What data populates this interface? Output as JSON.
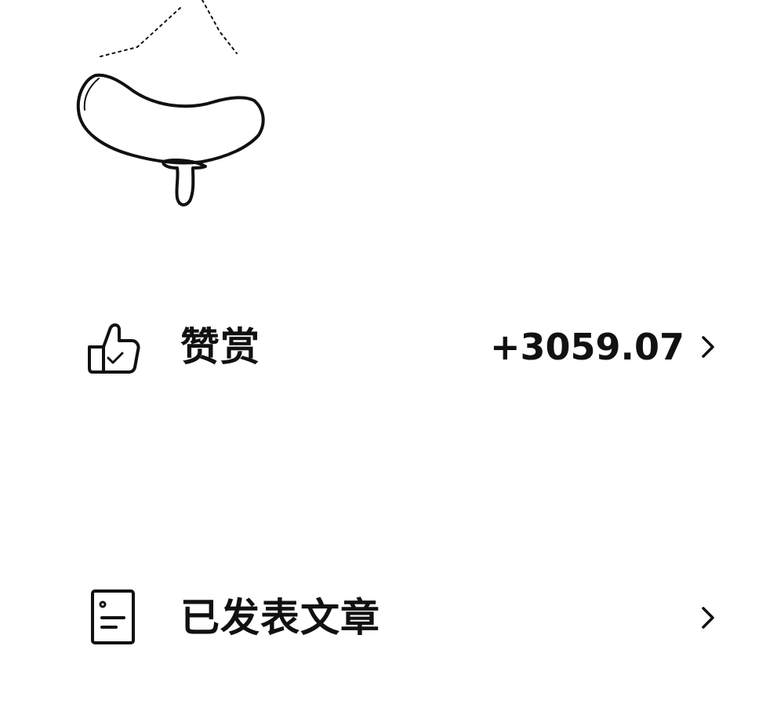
{
  "illustration": {
    "icon": "sausage-doodle"
  },
  "menu": {
    "items": [
      {
        "icon": "thumbs-up-icon",
        "label": "赞赏",
        "value": "+3059.07",
        "chevron": "chevron-right-icon"
      },
      {
        "icon": "document-icon",
        "label": "已发表文章",
        "value": "",
        "chevron": "chevron-right-icon"
      }
    ]
  }
}
